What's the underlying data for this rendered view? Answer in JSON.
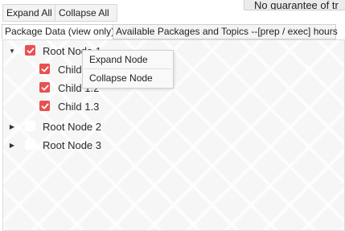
{
  "toolbar": {
    "expand_all": "Expand All",
    "collapse_all": "Collapse All"
  },
  "notice": {
    "text": "No guarantee of tr"
  },
  "tabs": [
    {
      "label": "Package Data (view only)",
      "selected": true
    },
    {
      "label": "Available Packages and Topics --[prep / exec] hours",
      "selected": false
    }
  ],
  "tree": {
    "root1": {
      "label": "Root Node 1",
      "checked": true,
      "expanded": true
    },
    "children": [
      {
        "label": "Child 1.1",
        "checked": true
      },
      {
        "label": "Child 1.2",
        "checked": true
      },
      {
        "label": "Child 1.3",
        "checked": true
      }
    ],
    "root2": {
      "label": "Root Node 2",
      "checked": false,
      "expanded": false
    },
    "root3": {
      "label": "Root Node 3",
      "checked": false,
      "expanded": false
    }
  },
  "context_menu": {
    "expand": "Expand Node",
    "collapse": "Collapse Node"
  },
  "colors": {
    "checkbox_checked": "#e9504f",
    "tab_border": "#cfcfcf"
  },
  "icons": {
    "expanded": "triangle-down-icon",
    "collapsed": "triangle-right-icon",
    "check": "check-icon"
  }
}
